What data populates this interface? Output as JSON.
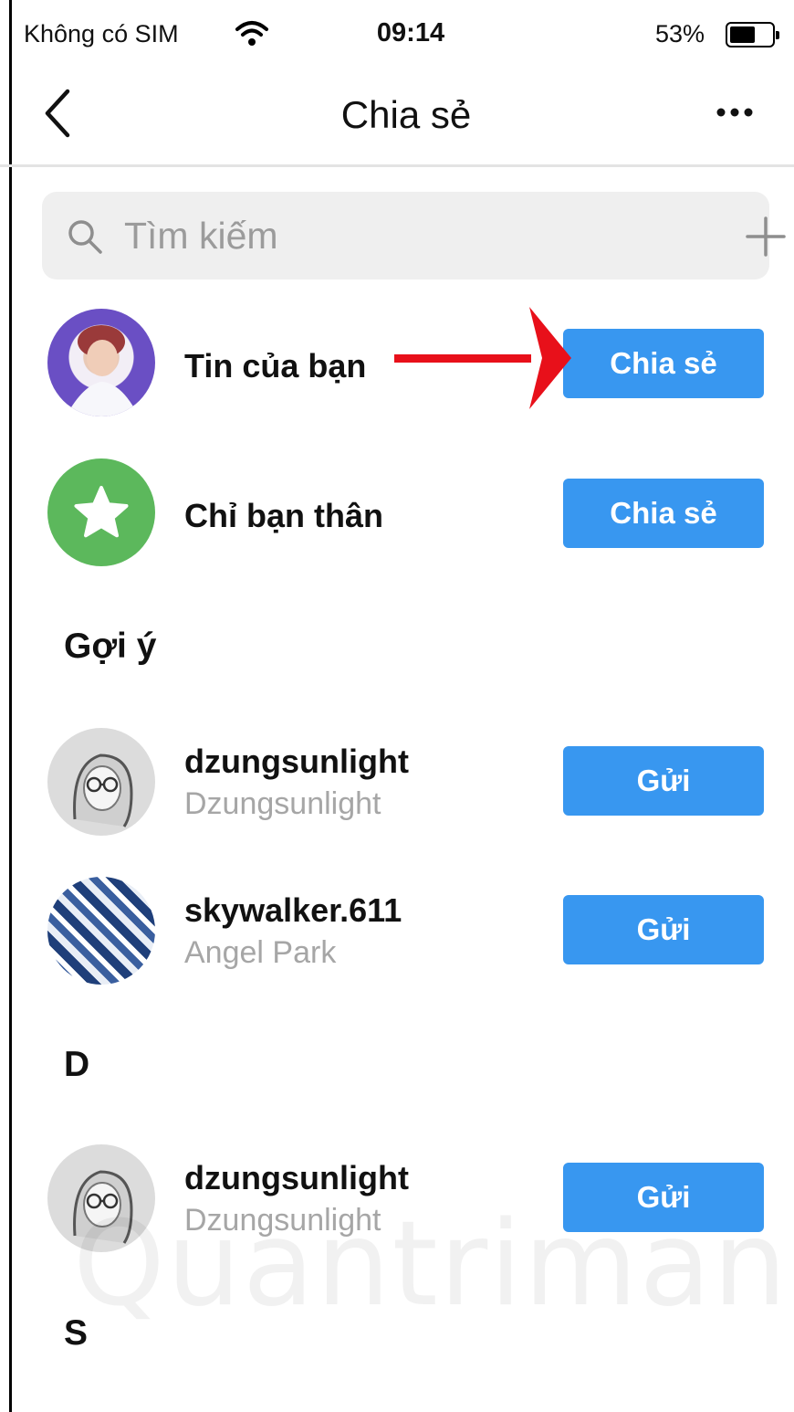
{
  "status_bar": {
    "carrier": "Không có SIM",
    "time": "09:14",
    "battery": "53%",
    "battery_level": 0.53
  },
  "header": {
    "title": "Chia sẻ",
    "back_icon": "chevron-left-icon",
    "more_icon": "ellipsis-icon"
  },
  "search": {
    "placeholder": "Tìm kiếm",
    "value": "",
    "add_icon": "plus-icon"
  },
  "story_rows": [
    {
      "label": "Tin của bạn",
      "button": "Chia sẻ"
    },
    {
      "label": "Chỉ bạn thân",
      "button": "Chia sẻ",
      "icon": "star-icon"
    }
  ],
  "sections": [
    {
      "title": "Gợi ý",
      "contacts": [
        {
          "username": "dzungsunlight",
          "name": "Dzungsunlight",
          "button": "Gửi"
        },
        {
          "username": "skywalker.611",
          "name": "Angel Park",
          "button": "Gửi"
        }
      ]
    },
    {
      "title": "D",
      "contacts": [
        {
          "username": "dzungsunlight",
          "name": "Dzungsunlight",
          "button": "Gửi"
        }
      ]
    },
    {
      "title": "S",
      "contacts": []
    }
  ],
  "colors": {
    "accent": "#3897f0",
    "close_friends": "#5cb85c",
    "annotation_arrow": "#e8101a"
  }
}
